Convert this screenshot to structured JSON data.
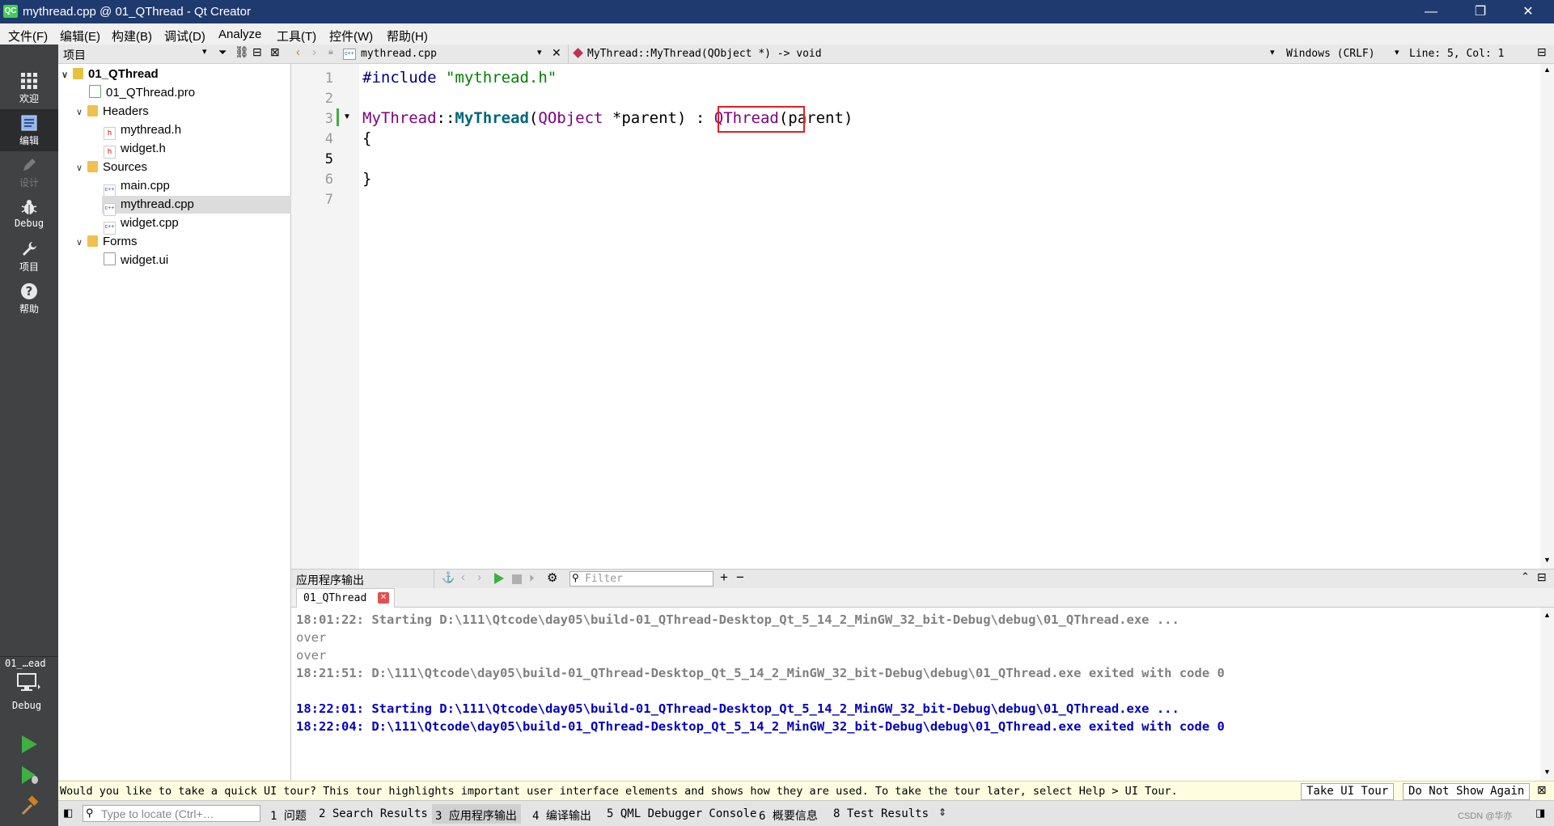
{
  "window": {
    "title": "mythread.cpp @ 01_QThread - Qt Creator",
    "logo": "QC",
    "minimize": "—",
    "restore": "❐",
    "close": "✕"
  },
  "menu": [
    "文件(F)",
    "编辑(E)",
    "构建(B)",
    "调试(D)",
    "Analyze",
    "工具(T)",
    "控件(W)",
    "帮助(H)"
  ],
  "modes": [
    {
      "label": "欢迎",
      "icon": "grid-icon"
    },
    {
      "label": "编辑",
      "icon": "edit-icon"
    },
    {
      "label": "设计",
      "icon": "pencil-icon"
    },
    {
      "label": "Debug",
      "icon": "bug-icon"
    },
    {
      "label": "项目",
      "icon": "wrench-icon"
    },
    {
      "label": "帮助",
      "icon": "help-icon"
    }
  ],
  "kit": {
    "name": "01_…ead",
    "config": "Debug"
  },
  "project_pane": {
    "title": "项目"
  },
  "tree": [
    {
      "label": "01_QThread",
      "level": 0,
      "kind": "project",
      "expanded": true,
      "bold": true
    },
    {
      "label": "01_QThread.pro",
      "level": 1,
      "kind": "pro"
    },
    {
      "label": "Headers",
      "level": 1,
      "kind": "folder-h",
      "expanded": true
    },
    {
      "label": "mythread.h",
      "level": 2,
      "kind": "h"
    },
    {
      "label": "widget.h",
      "level": 2,
      "kind": "h"
    },
    {
      "label": "Sources",
      "level": 1,
      "kind": "folder-cpp",
      "expanded": true
    },
    {
      "label": "main.cpp",
      "level": 2,
      "kind": "cpp"
    },
    {
      "label": "mythread.cpp",
      "level": 2,
      "kind": "cpp",
      "selected": true
    },
    {
      "label": "widget.cpp",
      "level": 2,
      "kind": "cpp"
    },
    {
      "label": "Forms",
      "level": 1,
      "kind": "folder-ui",
      "expanded": true
    },
    {
      "label": "widget.ui",
      "level": 2,
      "kind": "ui"
    }
  ],
  "editor_toolbar": {
    "file": "mythread.cpp",
    "symbol": "MyThread::MyThread(QObject *) -> void",
    "line_ending": "Windows (CRLF)",
    "position": "Line: 5, Col: 1"
  },
  "code": {
    "line_numbers": [
      "1",
      "2",
      "3",
      "4",
      "5",
      "6",
      "7"
    ],
    "line1": {
      "directive": "#include",
      "file": "\"mythread.h\""
    },
    "line3": {
      "cls": "MyThread",
      "sep": "::",
      "ctor": "MyThread",
      "open": "(",
      "type": "QObject",
      "ptr": " *",
      "param": "parent",
      "close": ")",
      "colon": " : ",
      "base": "QThread",
      "open2": "(",
      "arg": "parent",
      "close2": ")"
    },
    "line4": "{",
    "line6": "}"
  },
  "output": {
    "title": "应用程序输出",
    "filter_placeholder": "Filter",
    "tab": "01_QThread",
    "lines": [
      {
        "text": "18:01:22: Starting D:\\111\\Qtcode\\day05\\build-01_QThread-Desktop_Qt_5_14_2_MinGW_32_bit-Debug\\debug\\01_QThread.exe ...",
        "style": "gray"
      },
      {
        "text": "over",
        "style": "gray-normal"
      },
      {
        "text": "over",
        "style": "gray-normal"
      },
      {
        "text": "18:21:51: D:\\111\\Qtcode\\day05\\build-01_QThread-Desktop_Qt_5_14_2_MinGW_32_bit-Debug\\debug\\01_QThread.exe exited with code 0",
        "style": "gray"
      },
      {
        "text": "",
        "style": "gray"
      },
      {
        "text": "18:22:01: Starting D:\\111\\Qtcode\\day05\\build-01_QThread-Desktop_Qt_5_14_2_MinGW_32_bit-Debug\\debug\\01_QThread.exe ...",
        "style": "blue"
      },
      {
        "text": "18:22:04: D:\\111\\Qtcode\\day05\\build-01_QThread-Desktop_Qt_5_14_2_MinGW_32_bit-Debug\\debug\\01_QThread.exe exited with code 0",
        "style": "blue"
      }
    ]
  },
  "infobar": {
    "message": "Would you like to take a quick UI tour? This tour highlights important user interface elements and shows how they are used. To take the tour later, select Help > UI Tour.",
    "take_tour": "Take UI Tour",
    "dont_show": "Do Not Show Again",
    "close": "⊠"
  },
  "statusbar": {
    "locator_placeholder": "Type to locate (Ctrl+…",
    "tabs": [
      "1 问题",
      "2 Search Results",
      "3 应用程序输出",
      "4 编译输出",
      "5 QML Debugger Console",
      "6 概要信息",
      "8 Test Results"
    ],
    "watermark": "CSDN @华亦"
  },
  "colors": {
    "accent": "#1f3a6e",
    "keyword_purple": "#800080",
    "string_green": "#008000",
    "type_purple": "#800080",
    "highlight_red": "#e02020",
    "output_blue": "#0000c0",
    "output_gray": "#808080"
  }
}
